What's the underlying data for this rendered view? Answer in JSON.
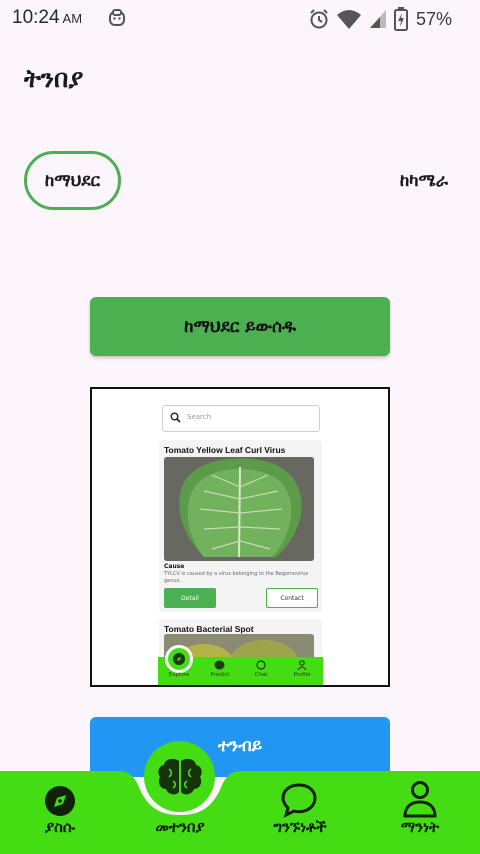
{
  "status_bar": {
    "time": "10:24",
    "ampm": "AM",
    "battery_percent": "57%"
  },
  "page": {
    "title": "ትንበያ"
  },
  "source_toggle": {
    "gallery_label": "ከማህደር",
    "camera_label": "ከካሜራ",
    "selected": "gallery"
  },
  "pick_button": {
    "label": "ከማህደር ይውሰዱ"
  },
  "preview": {
    "search_placeholder": "Search",
    "card1": {
      "title": "Tomato Yellow Leaf Curl Virus",
      "cause_label": "Cause",
      "cause_text": "TYLCV is caused by a virus belonging to the Begomovirus genus.",
      "detail_label": "Detail",
      "contact_label": "Contact"
    },
    "card2": {
      "title": "Tomato Bacterial Spot"
    },
    "nav": [
      "Explore",
      "Predict",
      "Chat",
      "Profile"
    ]
  },
  "predict_button": {
    "label": "ተንብይ"
  },
  "bottom_nav": {
    "items": [
      {
        "label": "ያስሱ",
        "icon": "compass-icon"
      },
      {
        "label": "መተንበያ",
        "icon": "brain-icon"
      },
      {
        "label": "ግንኙነቶች",
        "icon": "chat-bubble-icon"
      },
      {
        "label": "ማንነት",
        "icon": "person-icon"
      }
    ],
    "active_index": 1
  },
  "colors": {
    "accent_green": "#4caf50",
    "nav_green": "#44dd14",
    "predict_blue": "#2196f3",
    "background": "#fcf5fc"
  }
}
